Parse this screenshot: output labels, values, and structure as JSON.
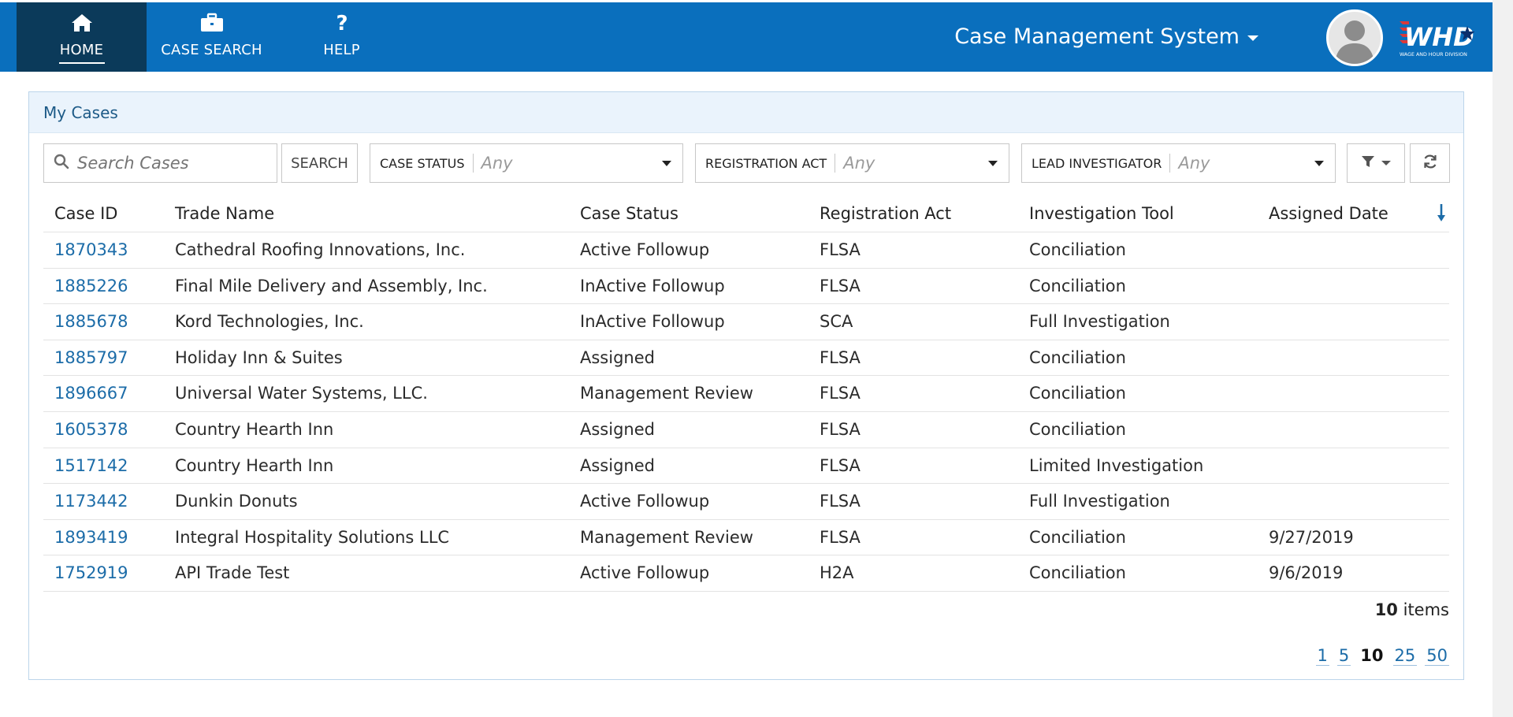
{
  "nav": {
    "tabs": [
      {
        "label": "HOME",
        "icon": "home-icon",
        "active": true
      },
      {
        "label": "CASE SEARCH",
        "icon": "briefcase-icon",
        "active": false
      },
      {
        "label": "HELP",
        "icon": "question-icon",
        "active": false
      }
    ]
  },
  "header": {
    "app_title": "Case Management System",
    "logo_text": "WHD",
    "logo_subtext": "WAGE AND HOUR DIVISION"
  },
  "colors": {
    "topbar": "#0a6fbd",
    "active_tab": "#0b3a5a",
    "link": "#1c6ca8",
    "panel_header": "#eaf3fc"
  },
  "panel": {
    "title": "My Cases",
    "search": {
      "placeholder": "Search Cases",
      "button_label": "SEARCH"
    },
    "filters": [
      {
        "label": "CASE STATUS",
        "value": "Any"
      },
      {
        "label": "REGISTRATION ACT",
        "value": "Any"
      },
      {
        "label": "LEAD INVESTIGATOR",
        "value": "Any"
      }
    ],
    "tools": [
      "filter-icon",
      "refresh-icon"
    ]
  },
  "table": {
    "columns": [
      "Case ID",
      "Trade Name",
      "Case Status",
      "Registration Act",
      "Investigation Tool",
      "Assigned Date"
    ],
    "sort": {
      "column": "Assigned Date",
      "direction": "descending"
    },
    "rows": [
      [
        "1870343",
        "Cathedral Roofing Innovations, Inc.",
        "Active Followup",
        "FLSA",
        "Conciliation",
        ""
      ],
      [
        "1885226",
        "Final Mile Delivery and Assembly, Inc.",
        "InActive Followup",
        "FLSA",
        "Conciliation",
        ""
      ],
      [
        "1885678",
        "Kord Technologies, Inc.",
        "InActive Followup",
        "SCA",
        "Full Investigation",
        ""
      ],
      [
        "1885797",
        "Holiday Inn & Suites",
        "Assigned",
        "FLSA",
        "Conciliation",
        ""
      ],
      [
        "1896667",
        "Universal Water Systems, LLC.",
        "Management Review",
        "FLSA",
        "Conciliation",
        ""
      ],
      [
        "1605378",
        "Country Hearth Inn",
        "Assigned",
        "FLSA",
        "Conciliation",
        ""
      ],
      [
        "1517142",
        "Country Hearth Inn",
        "Assigned",
        "FLSA",
        "Limited Investigation",
        ""
      ],
      [
        "1173442",
        "Dunkin Donuts",
        "Active Followup",
        "FLSA",
        "Full Investigation",
        ""
      ],
      [
        "1893419",
        "Integral Hospitality Solutions LLC",
        "Management Review",
        "FLSA",
        "Conciliation",
        "9/27/2019"
      ],
      [
        "1752919",
        "API Trade Test",
        "Active Followup",
        "H2A",
        "Conciliation",
        "9/6/2019"
      ]
    ]
  },
  "footer": {
    "items_count": "10",
    "items_label": "items",
    "page_sizes": [
      "1",
      "5",
      "10",
      "25",
      "50"
    ],
    "current_page_size": "10"
  }
}
